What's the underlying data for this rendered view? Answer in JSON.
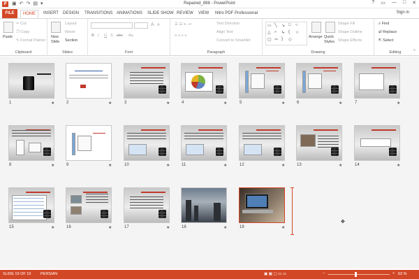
{
  "window": {
    "title": "Repaired_898 - PowerPoint",
    "sign_in": "Sign in",
    "app_icon_letter": "P",
    "controls": [
      "?",
      "▭",
      "—",
      "□",
      "✕"
    ]
  },
  "tabs": [
    "FILE",
    "HOME",
    "INSERT",
    "DESIGN",
    "TRANSITIONS",
    "ANIMATIONS",
    "SLIDE SHOW",
    "REVIEW",
    "VIEW",
    "Nitro PDF Professional"
  ],
  "ribbon": {
    "clipboard": {
      "label": "Clipboard",
      "paste": "Paste",
      "cut": "Cut",
      "copy": "Copy",
      "format_painter": "Format Painter"
    },
    "slides": {
      "label": "Slides",
      "new_slide": "New Slide",
      "layout": "Layout",
      "reset": "Reset",
      "section": "Section"
    },
    "font": {
      "label": "Font",
      "font_size_up": "A",
      "font_size_down": "A",
      "bold": "B",
      "italic": "I",
      "underline": "U",
      "shadow": "S",
      "strike": "abc",
      "case": "Aa"
    },
    "paragraph": {
      "label": "Paragraph",
      "text_direction": "Text Direction",
      "align_text": "Align Text",
      "convert_smartart": "Convert to SmartArt"
    },
    "drawing": {
      "label": "Drawing",
      "arrange": "Arrange",
      "quick_styles": "Quick Styles",
      "shape_fill": "Shape Fill",
      "shape_outline": "Shape Outline",
      "shape_effects": "Shape Effects"
    },
    "editing": {
      "label": "Editing",
      "find": "Find",
      "replace": "Replace",
      "select": "Select"
    }
  },
  "slides": [
    {
      "n": "1"
    },
    {
      "n": "2"
    },
    {
      "n": "3"
    },
    {
      "n": "4"
    },
    {
      "n": "5"
    },
    {
      "n": "6"
    },
    {
      "n": "7"
    },
    {
      "n": "8"
    },
    {
      "n": "9"
    },
    {
      "n": "10"
    },
    {
      "n": "11"
    },
    {
      "n": "12"
    },
    {
      "n": "13"
    },
    {
      "n": "14"
    },
    {
      "n": "15"
    },
    {
      "n": "16"
    },
    {
      "n": "17"
    },
    {
      "n": "18"
    },
    {
      "n": "19"
    }
  ],
  "slide_star": "★",
  "status": {
    "slide_of": "SLIDE 19 OF 19",
    "language": "PERSIAN",
    "zoom": "63 %"
  },
  "colors": {
    "accent": "#d24726",
    "slide_bg_top": "#c9c9c9"
  }
}
